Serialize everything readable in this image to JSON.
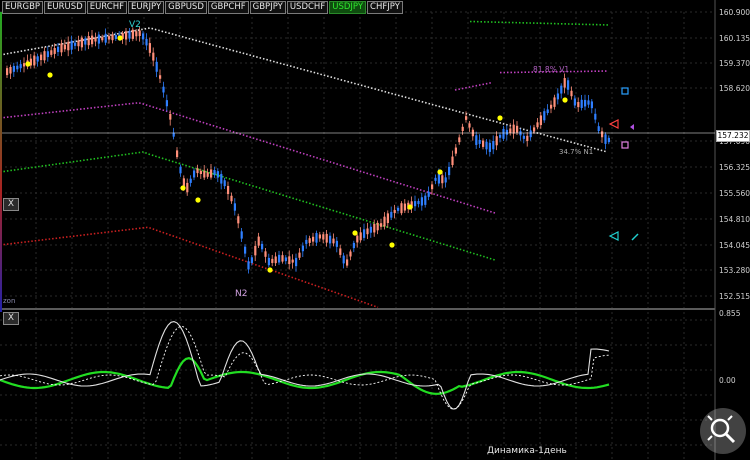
{
  "tabs": [
    {
      "label": "EURGBP",
      "active": false
    },
    {
      "label": "EURUSD",
      "active": false
    },
    {
      "label": "EURCHF",
      "active": false
    },
    {
      "label": "EURJPY",
      "active": false
    },
    {
      "label": "GBPUSD",
      "active": false
    },
    {
      "label": "GBPCHF",
      "active": false
    },
    {
      "label": "GBPJPY",
      "active": false
    },
    {
      "label": "USDCHF",
      "active": false
    },
    {
      "label": "USDJPY",
      "active": true
    },
    {
      "label": "CHFJPY",
      "active": false
    }
  ],
  "price_axis": [
    "160.900",
    "160.135",
    "159.370",
    "158.620",
    "157.090",
    "156.325",
    "155.560",
    "154.810",
    "154.045",
    "153.280",
    "152.515"
  ],
  "current_price": "157.232",
  "indicator_axis": [
    "0.855",
    "0.00"
  ],
  "close_label": "X",
  "wave_labels": {
    "v2": "V2",
    "n2": "N2"
  },
  "fib_labels": {
    "upper": "81.8% V1",
    "lower": "34.7% N1"
  },
  "small_label": "zon",
  "indicator_title": "Динамика-1день",
  "colors": {
    "up_candle": "#2f7fff",
    "down_candle": "#ff8f7a",
    "white_line": "#e0e0e0",
    "magenta_line": "#c040c0",
    "green_line": "#20c020",
    "red_line": "#cc2020",
    "yellow_dot": "#ffff00",
    "osc_green": "#22dd22"
  },
  "icons": [
    "close-icon",
    "zoom-icon",
    "buy-signal-icon",
    "sell-signal-icon",
    "arrow-icon"
  ]
}
